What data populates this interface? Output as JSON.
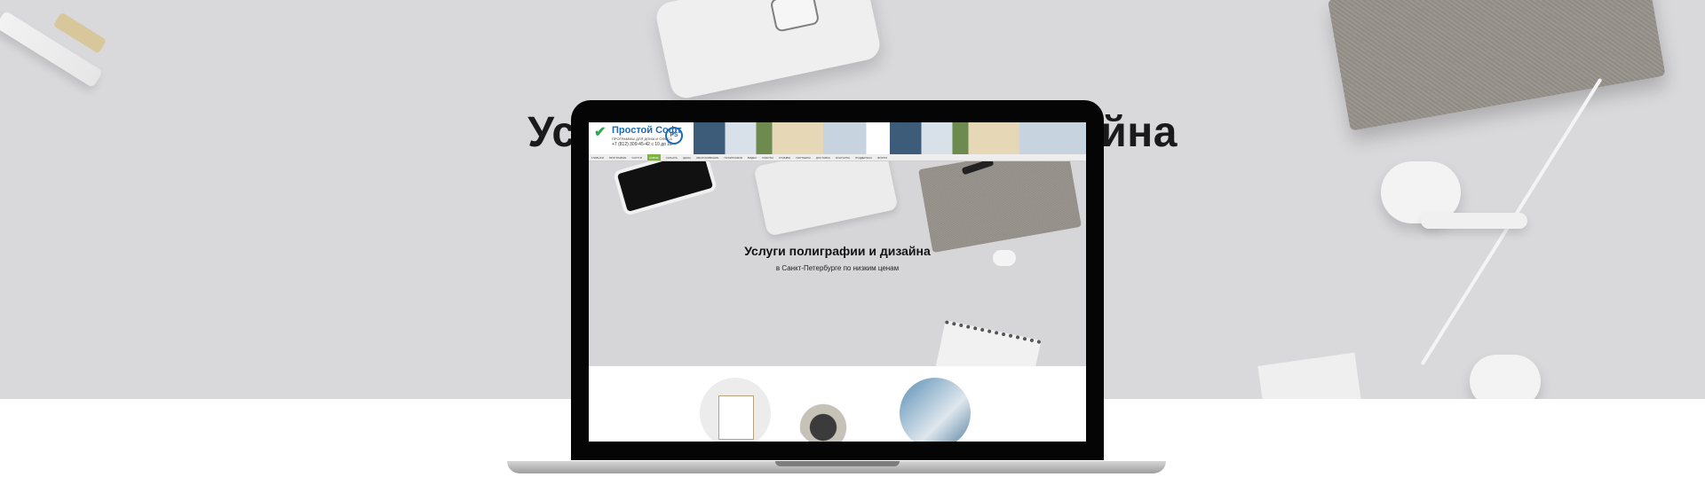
{
  "hero": {
    "title": "Услуги полиграфии и дизайна"
  },
  "site": {
    "logo": {
      "name": "Простой Софт",
      "tagline": "ПРОГРАММЫ ДЛЯ ДОМА И ОФИСА",
      "phone": "+7 (812) 309-45-42 с 10 до 18",
      "badge": "PS"
    },
    "nav": {
      "items": [
        "ГЛАВНАЯ",
        "ПРОГРАММЫ",
        "УСЛУГИ",
        "НОВОЕ",
        "СКАЧАТЬ",
        "ЦЕНЫ",
        "ОБСЛУЖИВАНИЕ",
        "ПОЛИГРАФИЯ",
        "ВИДЕО",
        "РАБОТЫ",
        "ОТЗЫВЫ",
        "ПАРТНЕРЫ",
        "ДОСТАВКА",
        "КОНТАКТЫ",
        "ПОДДЕРЖКА",
        "ФОРУМ"
      ],
      "active_index": 3
    },
    "hero": {
      "title": "Услуги полиграфии и дизайна",
      "subtitle": "в Санкт-Петербурге по низким ценам"
    }
  }
}
